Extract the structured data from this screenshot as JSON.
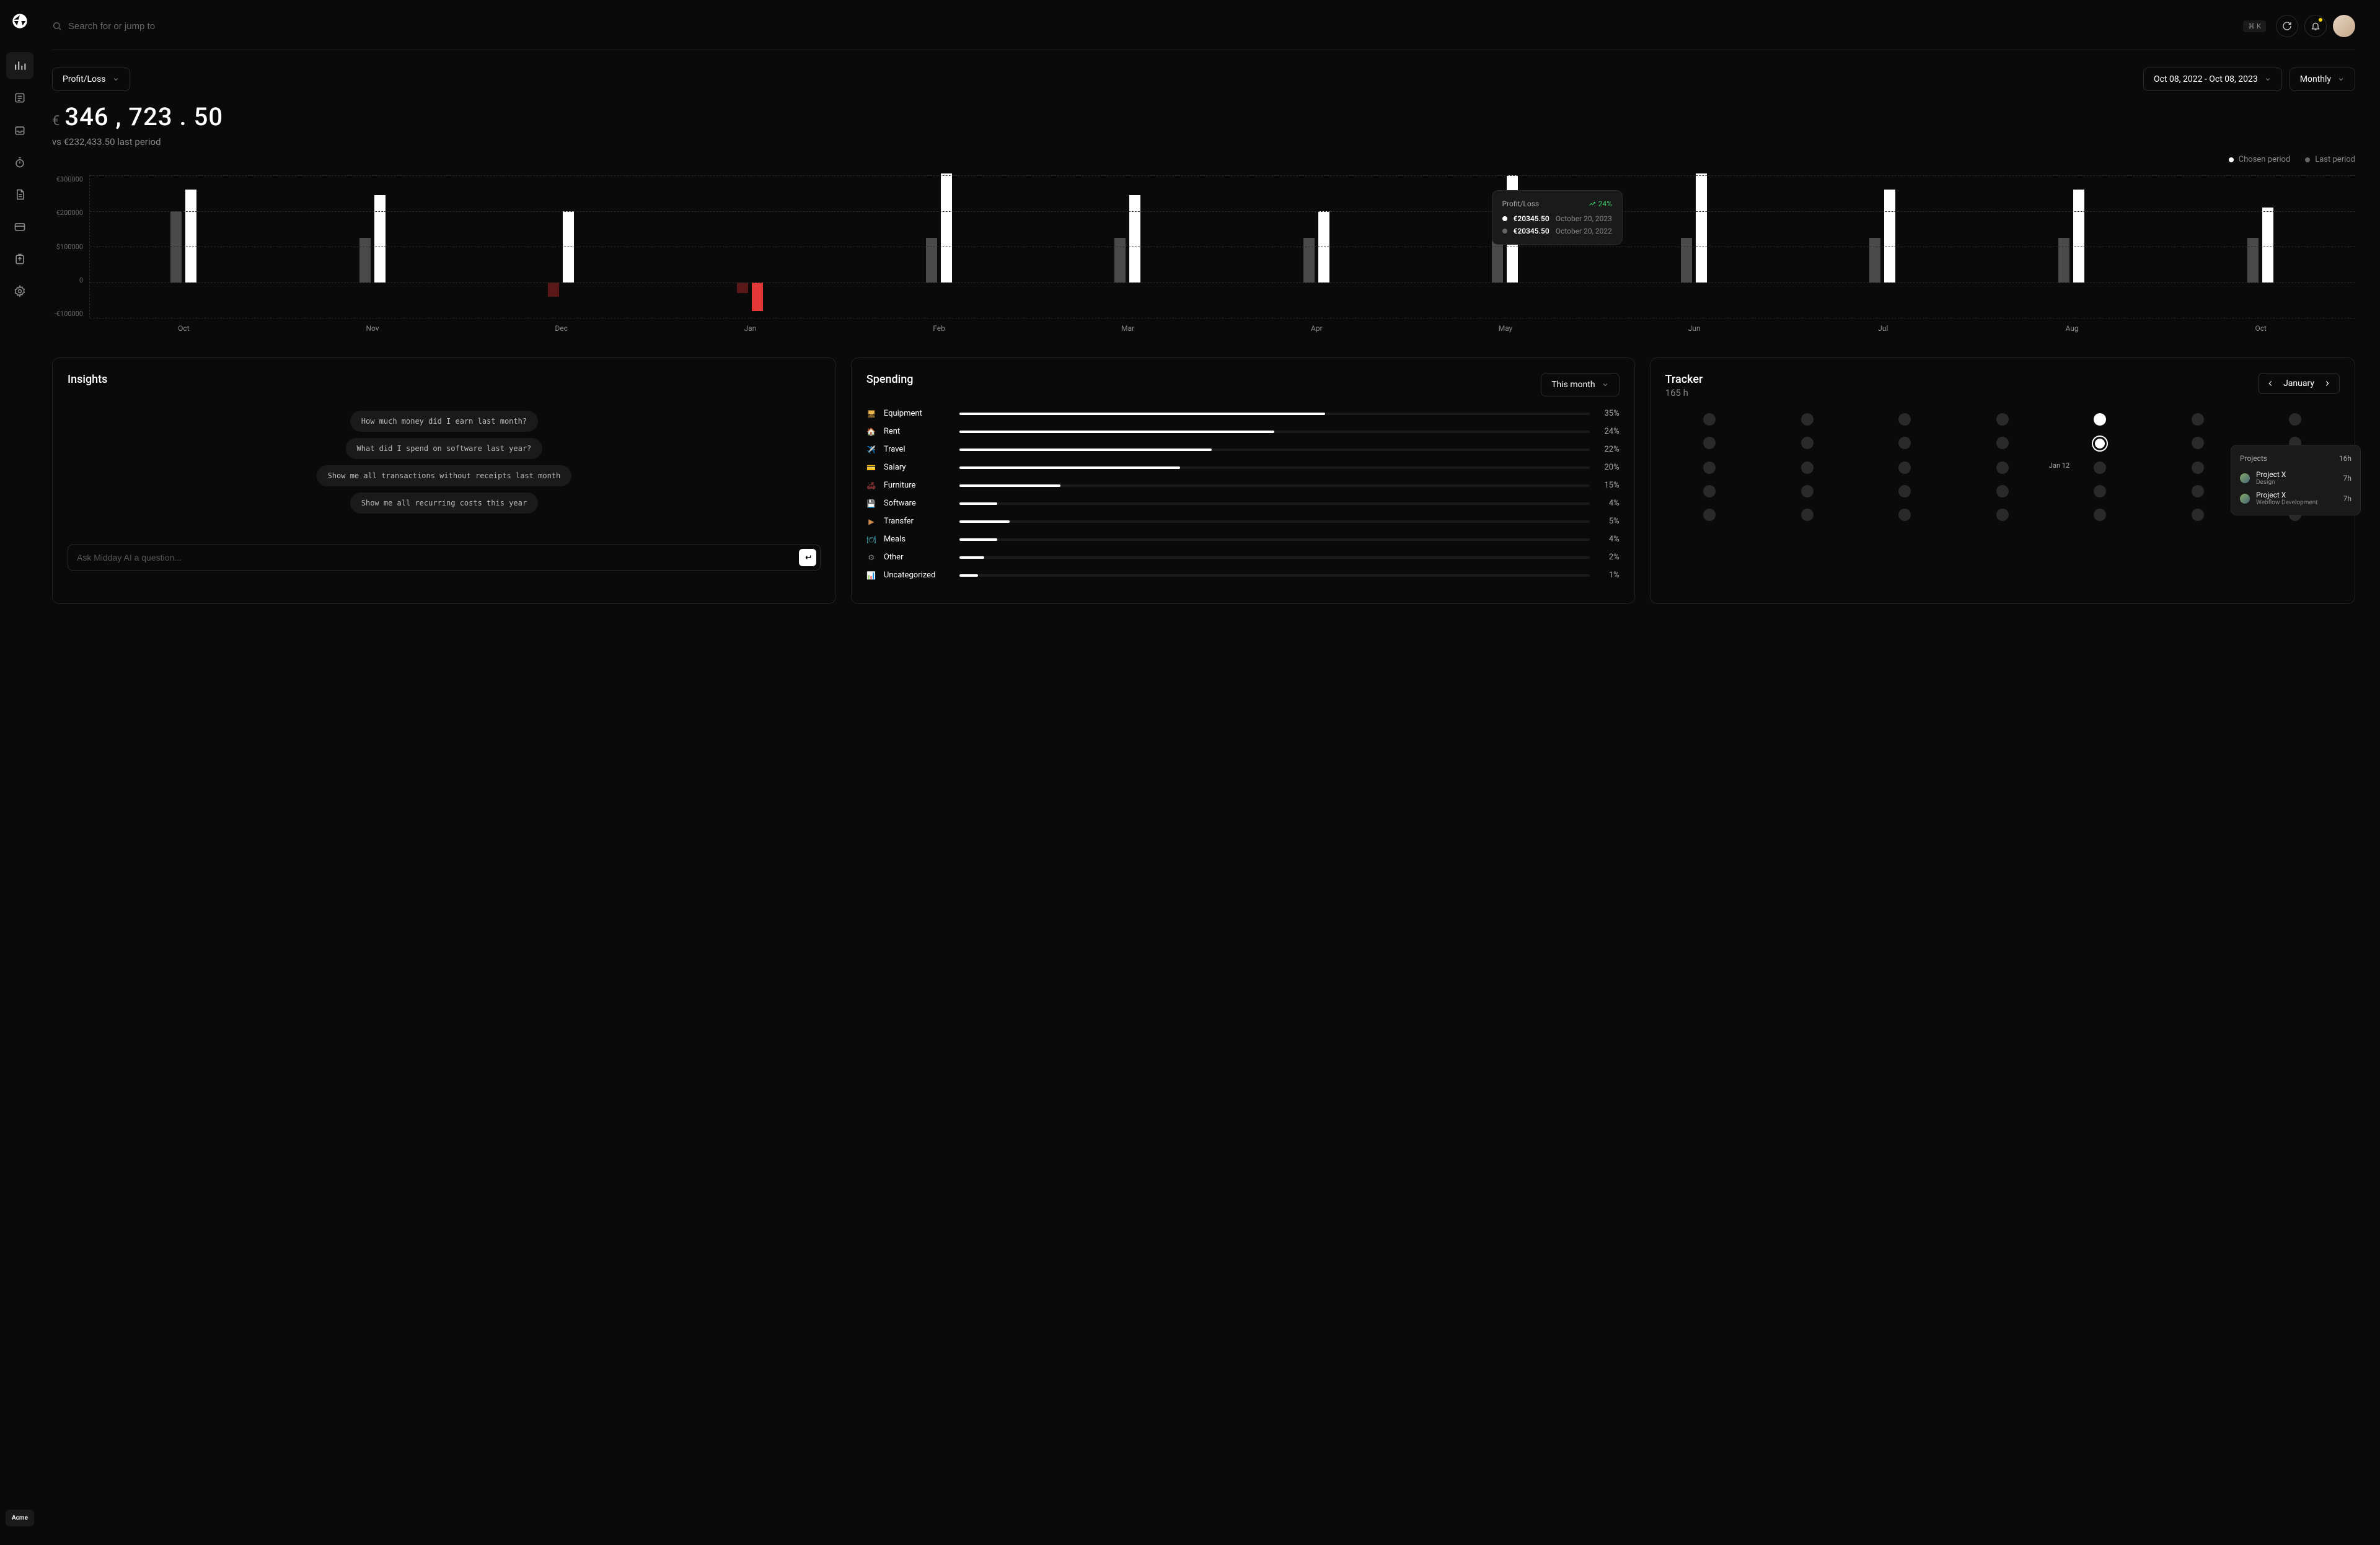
{
  "header": {
    "search_placeholder": "Search for or jump to",
    "shortcut": "⌘ K"
  },
  "sidebar": {
    "items": [
      {
        "name": "chart",
        "active": true
      },
      {
        "name": "list"
      },
      {
        "name": "inbox"
      },
      {
        "name": "timer"
      },
      {
        "name": "document"
      },
      {
        "name": "card"
      },
      {
        "name": "export"
      },
      {
        "name": "settings"
      }
    ],
    "footer": "Acme"
  },
  "controls": {
    "metric": "Profit/Loss",
    "date_range": "Oct 08, 2022 - Oct 08, 2023",
    "interval": "Monthly"
  },
  "summary": {
    "currency": "€",
    "value": "346 , 723 . 50",
    "comparison": "vs €232,433.50 last period"
  },
  "legend": {
    "chosen": "Chosen period",
    "last": "Last period"
  },
  "tooltip": {
    "title": "Profit/Loss",
    "pct": "24%",
    "rows": [
      {
        "value": "€20345.50",
        "date": "October 20, 2023"
      },
      {
        "value": "€20345.50",
        "date": "October 20, 2022"
      }
    ]
  },
  "chart_data": {
    "type": "bar",
    "ylabel": "",
    "ylim": [
      -100000,
      300000
    ],
    "yticks": [
      "€300000",
      "€200000",
      "$100000",
      "0",
      "-€100000"
    ],
    "categories": [
      "Oct",
      "Nov",
      "Dec",
      "Jan",
      "Feb",
      "Mar",
      "Apr",
      "May",
      "Jun",
      "Jul",
      "Aug",
      "Oct"
    ],
    "series": [
      {
        "name": "Last period",
        "values": [
          200000,
          125000,
          -40000,
          -30000,
          125000,
          125000,
          125000,
          200000,
          125000,
          125000,
          125000,
          125000
        ]
      },
      {
        "name": "Chosen period",
        "values": [
          260000,
          245000,
          200000,
          -80000,
          305000,
          245000,
          200000,
          300000,
          305000,
          260000,
          260000,
          210000
        ]
      }
    ]
  },
  "insights": {
    "title": "Insights",
    "chips": [
      "How much money did I earn last month?",
      "What did I spend on software last year?",
      "Show me all transactions without receipts last month",
      "Show me all recurring costs this year"
    ],
    "input_placeholder": "Ask Midday AI a question..."
  },
  "spending": {
    "title": "Spending",
    "period": "This month",
    "rows": [
      {
        "icon": "🖥",
        "label": "Equipment",
        "pct": "35%",
        "fill": 58,
        "color": "#f0b84a"
      },
      {
        "icon": "🏠",
        "label": "Rent",
        "pct": "24%",
        "fill": 50,
        "color": "#b94ad6"
      },
      {
        "icon": "✈️",
        "label": "Travel",
        "pct": "22%",
        "fill": 40,
        "color": "#3cc76a"
      },
      {
        "icon": "💳",
        "label": "Salary",
        "pct": "20%",
        "fill": 35,
        "color": "#2da864"
      },
      {
        "icon": "🛋",
        "label": "Furniture",
        "pct": "15%",
        "fill": 16,
        "color": "#d04a4a"
      },
      {
        "icon": "💾",
        "label": "Software",
        "pct": "4%",
        "fill": 6,
        "color": "#4a7cd0"
      },
      {
        "icon": "▶",
        "label": "Transfer",
        "pct": "5%",
        "fill": 8,
        "color": "#d08a4a"
      },
      {
        "icon": "🍽",
        "label": "Meals",
        "pct": "4%",
        "fill": 6,
        "color": "#4abfd0"
      },
      {
        "icon": "⚙",
        "label": "Other",
        "pct": "2%",
        "fill": 4,
        "color": "#888"
      },
      {
        "icon": "📊",
        "label": "Uncategorized",
        "pct": "1%",
        "fill": 3,
        "color": "#888"
      }
    ]
  },
  "tracker": {
    "title": "Tracker",
    "subtitle": "165 h",
    "month": "January",
    "selected_label": "Jan 12",
    "popup": {
      "title": "Projects",
      "total": "16h",
      "projects": [
        {
          "name": "Project X",
          "desc": "Design",
          "hours": "7h"
        },
        {
          "name": "Project X",
          "desc": "Webflow Development",
          "hours": "7h"
        }
      ]
    }
  }
}
